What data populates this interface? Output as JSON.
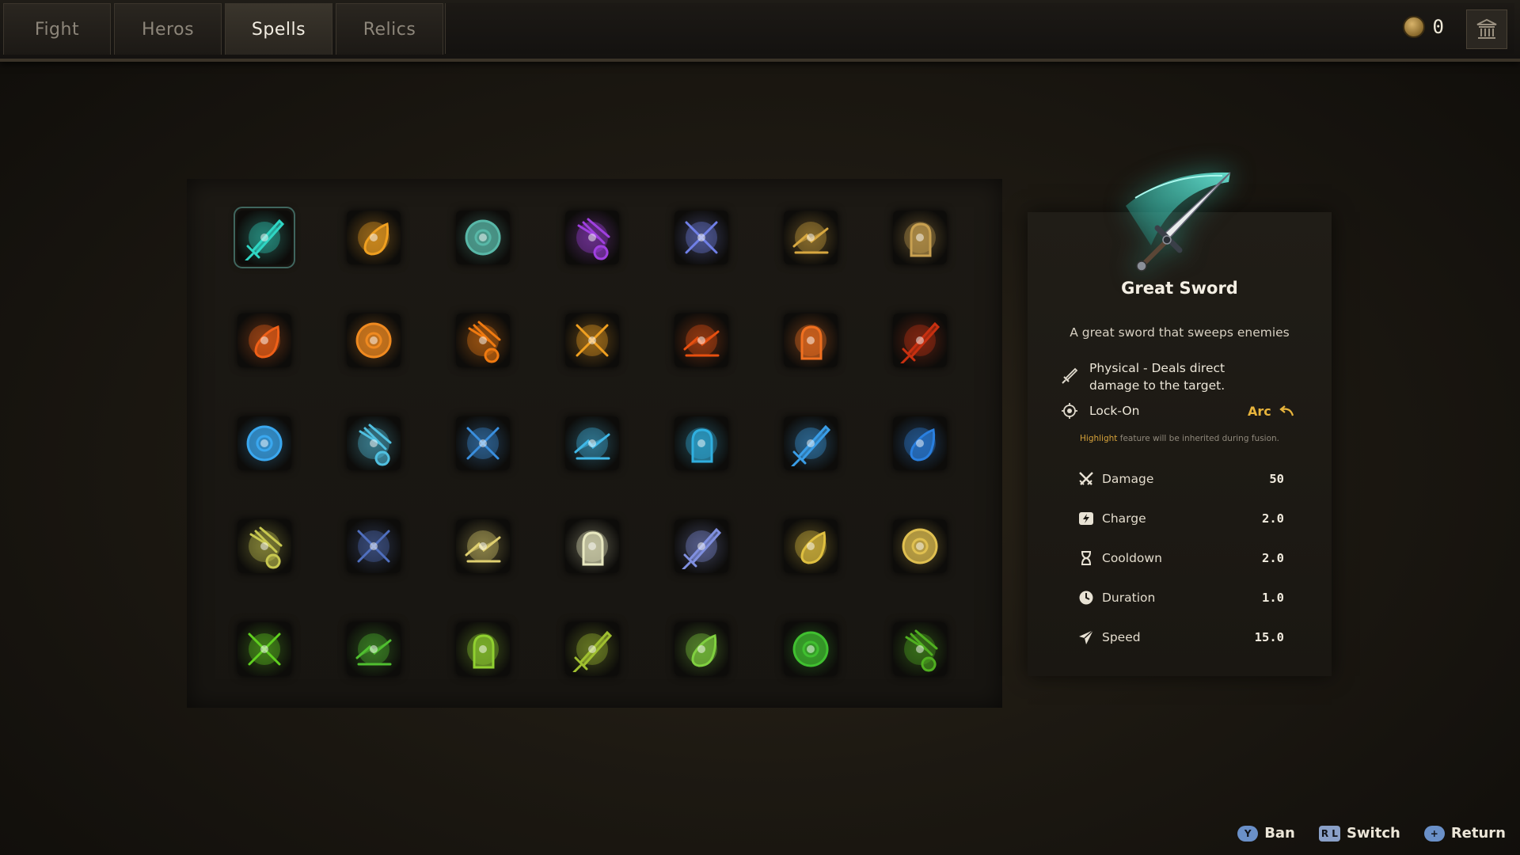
{
  "tabs": [
    {
      "label": "Fight",
      "active": false
    },
    {
      "label": "Heros",
      "active": false
    },
    {
      "label": "Spells",
      "active": true
    },
    {
      "label": "Relics",
      "active": false
    }
  ],
  "currency": {
    "count": "0",
    "icon": "coin-icon"
  },
  "selected_spell": {
    "name": "Great Sword",
    "description": "A great sword that sweeps enemies",
    "type_line1": "Physical - Deals direct",
    "type_line2": "damage to the target.",
    "targeting": "Lock-On",
    "shape": "Arc",
    "hint_highlight": "Highlight",
    "hint_rest": " feature will be inherited during fusion.",
    "stats": [
      {
        "label": "Damage",
        "value": "50",
        "icon": "crossed-swords-icon"
      },
      {
        "label": "Charge",
        "value": "2.0",
        "icon": "charge-icon"
      },
      {
        "label": "Cooldown",
        "value": "2.0",
        "icon": "hourglass-icon"
      },
      {
        "label": "Duration",
        "value": "1.0",
        "icon": "clock-icon"
      },
      {
        "label": "Speed",
        "value": "15.0",
        "icon": "paper-plane-icon"
      }
    ]
  },
  "spell_grid": [
    [
      {
        "icon": "great-sword-icon",
        "color": "#2fd6c4"
      },
      {
        "icon": "fireball-icon",
        "color": "#f0a020"
      },
      {
        "icon": "spiked-shield-icon",
        "color": "#58b8a8"
      },
      {
        "icon": "purple-meteors-icon",
        "color": "#a040e0"
      },
      {
        "icon": "cross-slash-icon",
        "color": "#7080e8"
      },
      {
        "icon": "earth-crack-icon",
        "color": "#d8a840"
      },
      {
        "icon": "stone-fist-icon",
        "color": "#c8a050"
      }
    ],
    [
      {
        "icon": "fire-bolt-icon",
        "color": "#f06018"
      },
      {
        "icon": "fire-wave-icon",
        "color": "#f08a20"
      },
      {
        "icon": "flames-icon",
        "color": "#f07a10"
      },
      {
        "icon": "fire-dragon-icon",
        "color": "#f0a020"
      },
      {
        "icon": "fire-orb-icon",
        "color": "#e85010"
      },
      {
        "icon": "fire-slash-icon",
        "color": "#f07020"
      },
      {
        "icon": "volcano-icon",
        "color": "#c83010"
      }
    ],
    [
      {
        "icon": "ice-comet-icon",
        "color": "#3aa8f0"
      },
      {
        "icon": "frost-axe-icon",
        "color": "#50c0e0"
      },
      {
        "icon": "ice-shards-icon",
        "color": "#3a90e0"
      },
      {
        "icon": "ice-lance-icon",
        "color": "#40b8e8"
      },
      {
        "icon": "tornado-icon",
        "color": "#30b0e0"
      },
      {
        "icon": "ice-burst-icon",
        "color": "#3a9ee8"
      },
      {
        "icon": "water-vortex-icon",
        "color": "#2a80e0"
      }
    ],
    [
      {
        "icon": "lightning-web-icon",
        "color": "#c8c850"
      },
      {
        "icon": "thunder-hammer-icon",
        "color": "#5070c0"
      },
      {
        "icon": "lightning-arc-icon",
        "color": "#e0d070"
      },
      {
        "icon": "lightning-orb-icon",
        "color": "#e8e8c0"
      },
      {
        "icon": "lightning-crystal-icon",
        "color": "#8090e0"
      },
      {
        "icon": "lightning-strike-icon",
        "color": "#e0c040"
      },
      {
        "icon": "lightning-field-icon",
        "color": "#e0c050"
      }
    ],
    [
      {
        "icon": "green-vortex-icon",
        "color": "#60d020"
      },
      {
        "icon": "poison-orb-icon",
        "color": "#50c030"
      },
      {
        "icon": "leaf-blade-icon",
        "color": "#90d030"
      },
      {
        "icon": "vine-icon",
        "color": "#a0c030"
      },
      {
        "icon": "leaf-icon",
        "color": "#80d040"
      },
      {
        "icon": "cobra-icon",
        "color": "#40c030"
      },
      {
        "icon": "forest-spirit-icon",
        "color": "#50b020"
      }
    ]
  ],
  "prompts": [
    {
      "glyph": "Y",
      "label": "Ban"
    },
    {
      "glyph": "R L",
      "label": "Switch"
    },
    {
      "glyph": "+",
      "label": "Return"
    }
  ]
}
